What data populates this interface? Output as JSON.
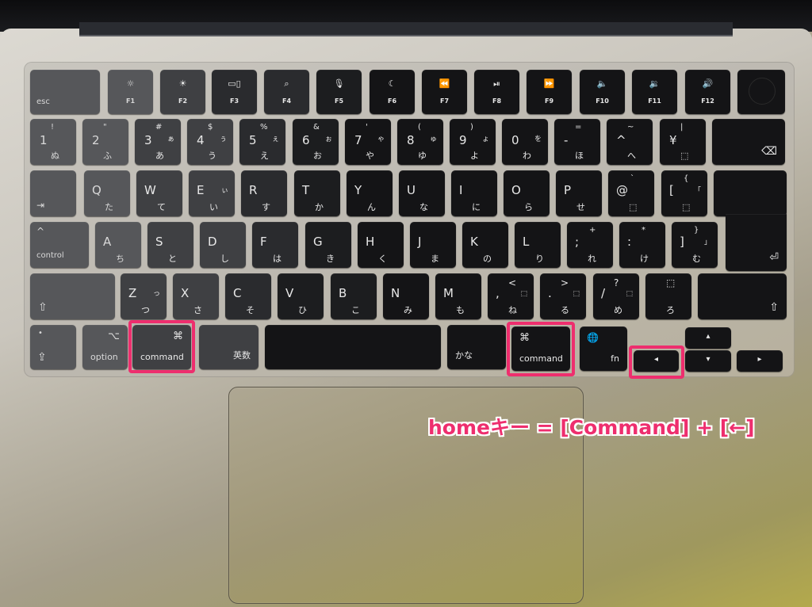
{
  "caption": {
    "text": "homeキー = [Command] + [←]",
    "color": "#ee2e6e"
  },
  "highlight_color": "#ee2e6e",
  "function_row": [
    {
      "label": "esc",
      "icon": ""
    },
    {
      "label": "F1",
      "icon": "☼"
    },
    {
      "label": "F2",
      "icon": "☀"
    },
    {
      "label": "F3",
      "icon": "▭▯"
    },
    {
      "label": "F4",
      "icon": "⌕"
    },
    {
      "label": "F5",
      "icon": "🎙"
    },
    {
      "label": "F6",
      "icon": "☾"
    },
    {
      "label": "F7",
      "icon": "⏪"
    },
    {
      "label": "F8",
      "icon": "⏯"
    },
    {
      "label": "F9",
      "icon": "⏩"
    },
    {
      "label": "F10",
      "icon": "🔈"
    },
    {
      "label": "F11",
      "icon": "🔉"
    },
    {
      "label": "F12",
      "icon": "🔊"
    },
    {
      "label": "",
      "icon": "touch-id"
    }
  ],
  "number_row": [
    {
      "main": "1",
      "shift": "!",
      "kana": "ぬ",
      "kana_small": ""
    },
    {
      "main": "2",
      "shift": "\"",
      "kana": "ふ",
      "kana_small": ""
    },
    {
      "main": "3",
      "shift": "#",
      "kana": "あ",
      "kana_small": "ぁ"
    },
    {
      "main": "4",
      "shift": "$",
      "kana": "う",
      "kana_small": "ぅ"
    },
    {
      "main": "5",
      "shift": "%",
      "kana": "え",
      "kana_small": "ぇ"
    },
    {
      "main": "6",
      "shift": "&",
      "kana": "お",
      "kana_small": "ぉ"
    },
    {
      "main": "7",
      "shift": "'",
      "kana": "や",
      "kana_small": "ゃ"
    },
    {
      "main": "8",
      "shift": "(",
      "kana": "ゆ",
      "kana_small": "ゅ"
    },
    {
      "main": "9",
      "shift": ")",
      "kana": "よ",
      "kana_small": "ょ"
    },
    {
      "main": "0",
      "shift": "",
      "kana": "わ",
      "kana_small": "を"
    },
    {
      "main": "-",
      "shift": "=",
      "kana": "ほ",
      "kana_small": ""
    },
    {
      "main": "^",
      "shift": "~",
      "kana": "へ",
      "kana_small": ""
    },
    {
      "main": "¥",
      "shift": "|",
      "kana": "⬚",
      "kana_small": ""
    },
    {
      "main": "",
      "shift": "",
      "kana": "",
      "kana_small": "",
      "icon": "⌫"
    }
  ],
  "qwerty_row": [
    {
      "main": "",
      "kana": "",
      "icon": "⇥"
    },
    {
      "main": "Q",
      "kana": "た"
    },
    {
      "main": "W",
      "kana": "て"
    },
    {
      "main": "E",
      "kana": "い",
      "kana_small": "ぃ"
    },
    {
      "main": "R",
      "kana": "す"
    },
    {
      "main": "T",
      "kana": "か"
    },
    {
      "main": "Y",
      "kana": "ん"
    },
    {
      "main": "U",
      "kana": "な"
    },
    {
      "main": "I",
      "kana": "に"
    },
    {
      "main": "O",
      "kana": "ら"
    },
    {
      "main": "P",
      "kana": "せ"
    },
    {
      "main": "@",
      "shift": "`",
      "kana": "⬚"
    },
    {
      "main": "[",
      "shift": "{",
      "kana": "⬚",
      "kana_small": "「"
    }
  ],
  "home_row": [
    {
      "main": "control",
      "shift": "^"
    },
    {
      "main": "A",
      "kana": "ち"
    },
    {
      "main": "S",
      "kana": "と"
    },
    {
      "main": "D",
      "kana": "し"
    },
    {
      "main": "F",
      "kana": "は"
    },
    {
      "main": "G",
      "kana": "き"
    },
    {
      "main": "H",
      "kana": "く"
    },
    {
      "main": "J",
      "kana": "ま"
    },
    {
      "main": "K",
      "kana": "の"
    },
    {
      "main": "L",
      "kana": "り"
    },
    {
      "main": ";",
      "shift": "+",
      "kana": "れ"
    },
    {
      "main": ":",
      "shift": "*",
      "kana": "け"
    },
    {
      "main": "]",
      "shift": "}",
      "kana": "む",
      "kana_small": "」"
    }
  ],
  "return_key": {
    "icon": "⏎"
  },
  "shift_row": [
    {
      "main": "",
      "icon": "⇧"
    },
    {
      "main": "Z",
      "kana": "つ",
      "kana_small": "っ"
    },
    {
      "main": "X",
      "kana": "さ"
    },
    {
      "main": "C",
      "kana": "そ"
    },
    {
      "main": "V",
      "kana": "ひ"
    },
    {
      "main": "B",
      "kana": "こ"
    },
    {
      "main": "N",
      "kana": "み"
    },
    {
      "main": "M",
      "kana": "も"
    },
    {
      "main": ",",
      "shift": "<",
      "kana": "ね",
      "kana_small": "⬚"
    },
    {
      "main": ".",
      "shift": ">",
      "kana": "る",
      "kana_small": "⬚"
    },
    {
      "main": "/",
      "shift": "?",
      "kana": "め",
      "kana_small": "⬚"
    },
    {
      "main": "",
      "shift": "⬚",
      "kana": "ろ"
    },
    {
      "main": "",
      "icon": "⇧"
    }
  ],
  "bottom_row": {
    "caps": {
      "icon": "⇪",
      "dot": "•"
    },
    "option": {
      "label": "option",
      "icon": "⌥"
    },
    "command_left": {
      "label": "command",
      "icon": "⌘"
    },
    "eisu": {
      "label": "英数"
    },
    "space": {
      "label": ""
    },
    "kana": {
      "label": "かな"
    },
    "command_right": {
      "label": "command",
      "icon": "⌘"
    },
    "fn": {
      "label": "fn",
      "icon": "🌐"
    },
    "arrow_left": {
      "icon": "◂"
    },
    "arrow_up": {
      "icon": "▴"
    },
    "arrow_down": {
      "icon": "▾"
    },
    "arrow_right": {
      "icon": "▸"
    }
  }
}
